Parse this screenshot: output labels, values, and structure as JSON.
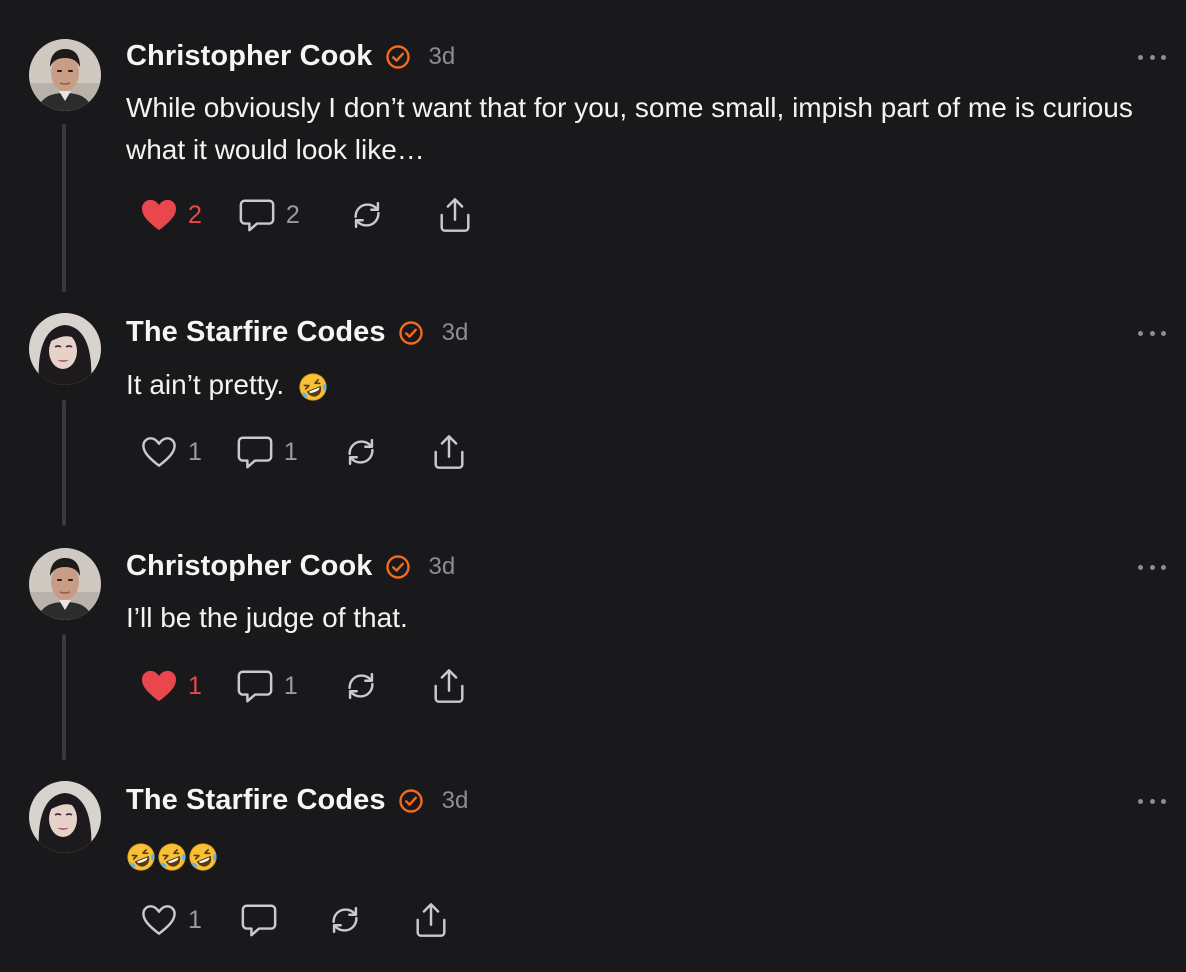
{
  "posts": [
    {
      "author": "Christopher Cook",
      "time": "3d",
      "text": "While obviously I don’t want that for you, some small, impish part of me is curious what it would look like…",
      "likes": "2",
      "liked": true,
      "replies": "2",
      "avatar": "man-portrait"
    },
    {
      "author": "The Starfire Codes",
      "time": "3d",
      "text": "It ain’t pretty.",
      "emoji_count": 1,
      "likes": "1",
      "liked": false,
      "replies": "1",
      "avatar": "woman-portrait"
    },
    {
      "author": "Christopher Cook",
      "time": "3d",
      "text": "I’ll be the judge of that.",
      "likes": "1",
      "liked": true,
      "replies": "1",
      "avatar": "man-portrait"
    },
    {
      "author": "The Starfire Codes",
      "time": "3d",
      "text": "",
      "emoji_count": 3,
      "likes": "1",
      "liked": false,
      "replies": "",
      "avatar": "woman-portrait"
    }
  ],
  "icons": {
    "verified": "verified-badge-icon",
    "like": "heart-icon",
    "reply": "comment-bubble-icon",
    "repost": "repost-icon",
    "share": "share-icon",
    "more": "more-options-icon",
    "emoji": "rolling-on-floor-laughing-emoji"
  },
  "colors": {
    "background": "#19191b",
    "accent_verified": "#f26b1d",
    "liked": "#e9464e",
    "muted": "#8d8d92"
  }
}
